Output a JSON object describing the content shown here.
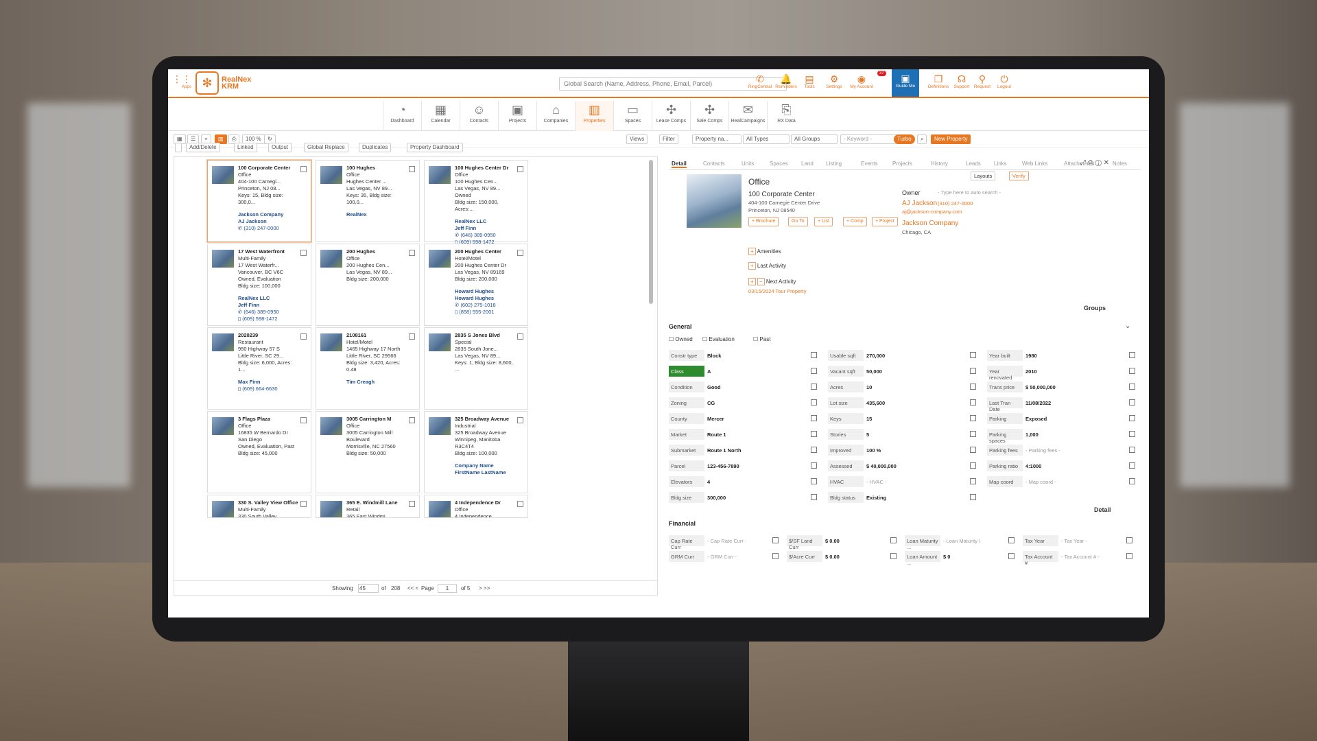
{
  "app": {
    "apps_label": "Apps",
    "logo": "RealNex KRM",
    "search_placeholder": "Global Search (Name, Address, Phone, Email, Parcel)",
    "reminder_count": "37"
  },
  "header_icons": [
    {
      "icon": "phone-icon",
      "label": "RingCentral"
    },
    {
      "icon": "bell-icon",
      "label": "Reminders"
    },
    {
      "icon": "tools-icon",
      "label": "Tools"
    },
    {
      "icon": "gear-icon",
      "label": "Settings"
    },
    {
      "icon": "account-icon",
      "label": "My Account"
    },
    {
      "icon": "guide-icon",
      "label": "Guide Me"
    },
    {
      "icon": "book-icon",
      "label": "Definitions"
    },
    {
      "icon": "headset-icon",
      "label": "Support"
    },
    {
      "icon": "pin-icon",
      "label": "Request"
    },
    {
      "icon": "logout-icon",
      "label": "Logout"
    }
  ],
  "modules": [
    "Dashboard",
    "Calendar",
    "Contacts",
    "Projects",
    "Companies",
    "Properties",
    "Spaces",
    "Lease Comps",
    "Sale Comps",
    "RealCampaigns",
    "RX Data"
  ],
  "toolbar": {
    "zoom": "100 %",
    "views": "Views",
    "filter": "Filter",
    "sort": "Property na...",
    "types": "All Types",
    "groups": "All Groups",
    "keyword": "- Keyword -",
    "turbo": "Turbo",
    "new_property": "New Property"
  },
  "list_toolbar": [
    "Add/Delete",
    "Linked",
    "Output",
    "Global Replace",
    "Duplicates",
    "Property Dashboard"
  ],
  "cards": [
    {
      "name": "100 Corporate Center",
      "type": "Office",
      "l1": "404-100 Carnegi...",
      "l2": "Princeton, NJ 08...",
      "l3": "Keys: 15, Bldg size: 300,0...",
      "c": "Jackson Company",
      "p": "AJ Jackson",
      "t1": "(310) 247-0000",
      "t2": ""
    },
    {
      "name": "100 Hughes",
      "type": "Office",
      "l1": "Hughes Center ...",
      "l2": "Las Vegas, NV 89...",
      "l3": "Keys: 35, Bldg size: 100,0...",
      "c": "RealNex",
      "p": "",
      "t1": "",
      "t2": ""
    },
    {
      "name": "100 Hughes Center Dr",
      "type": "Office",
      "l1": "100 Hughes Cen...",
      "l2": "Las Vegas, NV 89...",
      "l3": "Owned",
      "l4": "Bldg size: 150,000, Acres:...",
      "c": "RealNex LLC",
      "p": "Jeff Finn",
      "t1": "(646) 389-0950",
      "t2": "(609) 598-1472"
    },
    {
      "name": "17 West Waterfront",
      "type": "Multi-Family",
      "l1": "17 West Waterfr...",
      "l2": "Vancouver, BC V6C",
      "l3": "Owned, Evaluation",
      "l4": "Bldg size: 100,000",
      "c": "RealNex LLC",
      "p": "Jeff Finn",
      "t1": "(646) 389-0950",
      "t2": "(609) 598-1472"
    },
    {
      "name": "200 Hughes",
      "type": "Office",
      "l1": "200 Hughes Cen...",
      "l2": "Las Vegas, NV 89...",
      "l3": "Bldg size: 200,000",
      "c": "",
      "p": "",
      "t1": "",
      "t2": ""
    },
    {
      "name": "200 Hughes Center",
      "type": "Hotel/Motel",
      "l1": "200 Hughes Center Dr",
      "l2": "Las Vegas, NV 89169",
      "l3": "Bldg size: 200,000",
      "c": "Howard Hughes",
      "p": "Howard Hughes",
      "t1": "(602) 275-1018",
      "t2": "(858) 555-2001"
    },
    {
      "name": "2020239",
      "type": "Restaurant",
      "l1": "950 Highway 57 S",
      "l2": "Little River, SC 29...",
      "l3": "Bldg size: 6,000, Acres: 1...",
      "c": "",
      "p": "Max Finn",
      "t1": "",
      "t2": "(609) 664-6630"
    },
    {
      "name": "2108161",
      "type": "Hotel/Motel",
      "l1": "1465 Highway 17 North",
      "l2": "Little River, SC 29566",
      "l3": "Bldg size: 3,420, Acres: 0.48",
      "c": "",
      "p": "Tim Creagh",
      "t1": "",
      "t2": ""
    },
    {
      "name": "2835 S Jones Blvd",
      "type": "Special",
      "l1": "2835 South Jone...",
      "l2": "Las Vegas, NV 89...",
      "l3": "Keys: 1, Bldg size: 8,600, ...",
      "c": "",
      "p": "",
      "t1": "",
      "t2": ""
    },
    {
      "name": "3 Flags Plaza",
      "type": "Office",
      "l1": "16835 W Bernardo Dr",
      "l2": "San Diego",
      "l3": "Owned, Evaluation, Past",
      "l4": "Bldg size: 45,000",
      "c": "",
      "p": "",
      "t1": "",
      "t2": ""
    },
    {
      "name": "3005 Carrington M",
      "type": "Office",
      "l1": "3005 Carrington Mill Boulevard",
      "l2": "Morrisville, NC 27560",
      "l3": "Bldg size: 50,000",
      "c": "",
      "p": "",
      "t1": "",
      "t2": ""
    },
    {
      "name": "325 Broadway Avenue",
      "type": "Industrial",
      "l1": "325 Broadway Avenue",
      "l2": "Winnipeg, Manitoba R3C4T4",
      "l3": "Bldg size: 100,000",
      "c": "Company Name",
      "p": "FirstName LastName",
      "t1": "",
      "t2": ""
    },
    {
      "name": "330 S. Valley View Office",
      "type": "Multi-Family",
      "l1": "330 South Valley ...",
      "l2": "",
      "l3": "",
      "c": "",
      "p": "",
      "t1": "",
      "t2": ""
    },
    {
      "name": "365 E. Windmill Lane",
      "type": "Retail",
      "l1": "365 East Windmi...",
      "l2": "",
      "l3": "",
      "c": "",
      "p": "",
      "t1": "",
      "t2": ""
    },
    {
      "name": "4 Independence Dr",
      "type": "Office",
      "l1": "4 Independence ...",
      "l2": "",
      "l3": "",
      "c": "",
      "p": "",
      "t1": "",
      "t2": ""
    }
  ],
  "pager": {
    "showing": "Showing",
    "per": "45",
    "of": "of",
    "total": "208",
    "page": "Page",
    "page_no": "1",
    "of_pages": "of 5"
  },
  "detail": {
    "tabs": [
      "Detail",
      "Contacts",
      "Units",
      "Spaces",
      "Land",
      "Listing",
      "Events",
      "Projects",
      "History",
      "Leads",
      "Links",
      "Web Links",
      "Attachments",
      "Notes"
    ],
    "type": "Office",
    "name": "100 Corporate Center",
    "addr1": "404-100 Carnegie Center Drive",
    "addr2": "Princeton, NJ 08540",
    "buttons": [
      "+ Brochure",
      "Go To",
      "+ List",
      "+ Comp",
      "+ Project"
    ],
    "layouts": "Layouts",
    "verify": "Verify",
    "owner_label": "Owner",
    "owner_ph": "- Type here to auto search -",
    "owner_name": "AJ Jackson",
    "owner_phone": "(310) 247-0000",
    "owner_email": "aj@jackson-company.com",
    "owner_company": "Jackson Company",
    "owner_city": "Chicago, CA",
    "amenities": "Amenities",
    "last_activity": "Last Activity",
    "next_activity": "Next Activity",
    "next_item": "03/15/2024 Tour Property",
    "groups": "Groups",
    "general": "General",
    "flags": [
      "Owned",
      "Evaluation",
      "Past"
    ],
    "col1": [
      [
        "Constr type",
        "Block"
      ],
      [
        "Class",
        "A"
      ],
      [
        "Condition",
        "Good"
      ],
      [
        "Zoning",
        "CG"
      ],
      [
        "County",
        "Mercer"
      ],
      [
        "Market",
        "Route 1"
      ],
      [
        "Submarket",
        "Route 1 North"
      ],
      [
        "Parcel",
        "123-456-7890"
      ],
      [
        "Elevators",
        "4"
      ],
      [
        "Bldg size",
        "300,000"
      ]
    ],
    "col2": [
      [
        "Usable sqft",
        "270,000"
      ],
      [
        "Vacant sqft",
        "50,000"
      ],
      [
        "Acres",
        "10"
      ],
      [
        "Lot size",
        "435,600"
      ],
      [
        "Keys",
        "15"
      ],
      [
        "Stories",
        "5"
      ],
      [
        "Improved",
        "100 %"
      ],
      [
        "Assessed",
        "$ 40,000,000"
      ],
      [
        "HVAC",
        "- HVAC -"
      ],
      [
        "Bldg status",
        "Existing"
      ]
    ],
    "col3": [
      [
        "Year built",
        "1980"
      ],
      [
        "Year renovated",
        "2010"
      ],
      [
        "Trans price",
        "$ 50,000,000"
      ],
      [
        "Last Tran Date",
        "11/08/2022"
      ],
      [
        "Parking",
        "Exposed"
      ],
      [
        "Parking spaces",
        "1,000"
      ],
      [
        "Parking fees",
        "- Parking fees -"
      ],
      [
        "Parking ratio",
        "4:1000"
      ],
      [
        "Map coord",
        "- Map coord -"
      ]
    ],
    "detail_label": "Detail",
    "financial": "Financial",
    "fin": [
      [
        "Cap Rate Curr",
        "- Cap Rate Curr -"
      ],
      [
        "$/SF Land Curr",
        "$ 0.00"
      ],
      [
        "Loan Maturity ...",
        "- Loan Maturity I"
      ],
      [
        "Tax Year",
        "- Tax Year -"
      ],
      [
        "GRM Curr",
        "- GRM Curr -"
      ],
      [
        "$/Acre Curr",
        "$ 0.00"
      ],
      [
        "Loan Amount ...",
        "$ 0"
      ],
      [
        "Tax Account #",
        "- Tax Account # -"
      ]
    ]
  },
  "colors": {
    "accent": "#e87722",
    "link": "#1f4e8f",
    "class_green": "#2e8b2e"
  }
}
